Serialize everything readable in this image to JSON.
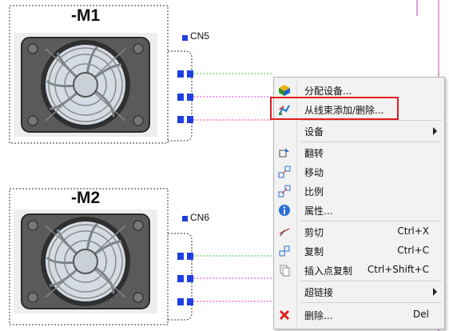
{
  "devices": [
    {
      "tag": "-M1",
      "connector": "CN5"
    },
    {
      "tag": "-M2",
      "connector": "CN6"
    }
  ],
  "context_menu": {
    "items": [
      {
        "label": "分配设备...",
        "icon": "assign-device-icon"
      },
      {
        "label": "从线束添加/删除...",
        "icon": "harness-add-remove-icon",
        "highlighted": true
      },
      {
        "label": "设备",
        "submenu": true
      },
      {
        "label": "翻转",
        "icon": "flip-icon"
      },
      {
        "label": "移动",
        "icon": "move-icon"
      },
      {
        "label": "比例",
        "icon": "scale-icon"
      },
      {
        "label": "属性...",
        "icon": "info-icon"
      },
      {
        "label": "剪切",
        "shortcut": "Ctrl+X",
        "icon": "cut-icon"
      },
      {
        "label": "复制",
        "shortcut": "Ctrl+C",
        "icon": "copy-icon"
      },
      {
        "label": "插入点复制",
        "shortcut": "Ctrl+Shift+C",
        "icon": "copy-at-point-icon"
      },
      {
        "label": "超链接",
        "submenu": true
      },
      {
        "label": "删除...",
        "shortcut": "Del",
        "icon": "delete-icon"
      }
    ]
  },
  "colors": {
    "pin_blue": "#1f3fe0",
    "wire_green": "#3fbf3f",
    "wire_magenta": "#e040c8",
    "highlight_red": "#e01e1e",
    "border_magenta": "#c040c0"
  }
}
